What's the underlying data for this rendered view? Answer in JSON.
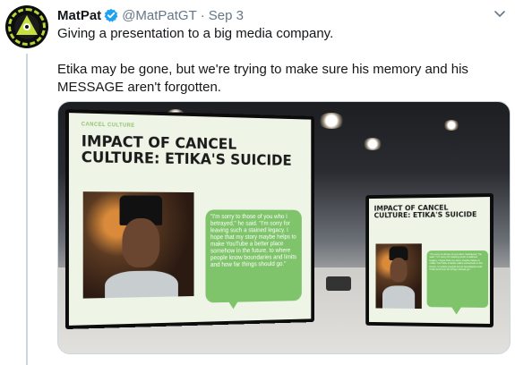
{
  "tweet": {
    "display_name": "MatPat",
    "handle": "@MatPatGT",
    "separator": "·",
    "date": "Sep 3",
    "text_line1": "Giving a presentation to a big media company.",
    "text_line2": "Etika may be gone, but we're trying to make sure his memory and his MESSAGE aren't forgotten."
  },
  "icons": {
    "verified": "verified-badge-icon",
    "caret": "chevron-down-icon"
  },
  "slide": {
    "kicker": "CANCEL CULTURE",
    "title": "IMPACT OF CANCEL CULTURE: ETIKA'S SUICIDE",
    "quote": "\"I'm sorry to those of you who I betrayed,\" he said. \"I'm sorry for leaving such a stained legacy. I hope that my story maybe helps to make YouTube a better place somehow in the future, to where people know boundaries and limits and how far things should go.\""
  },
  "colors": {
    "verified": "#1da1f2",
    "muted_text": "#657786",
    "slide_accent": "#7fc46a"
  }
}
